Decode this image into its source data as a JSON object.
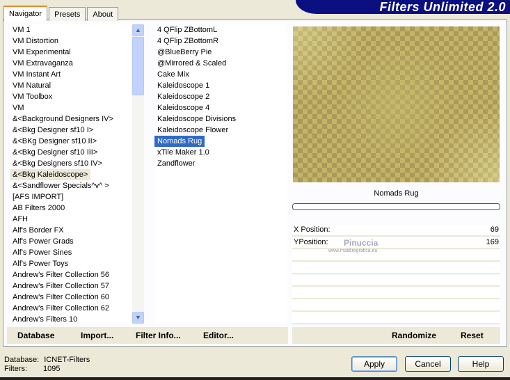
{
  "app": {
    "title": "Filters Unlimited 2.0"
  },
  "tabs": [
    {
      "label": "Navigator"
    },
    {
      "label": "Presets"
    },
    {
      "label": "About"
    }
  ],
  "categories": [
    "VM 1",
    "VM Distortion",
    "VM Experimental",
    "VM Extravaganza",
    "VM Instant Art",
    "VM Natural",
    "VM Toolbox",
    "VM",
    "&<Background Designers IV>",
    "&<Bkg Designer sf10 I>",
    "&<BKg Designer sf10 II>",
    "&<Bkg Designer sf10 III>",
    "&<Bkg Designers sf10 IV>",
    "&<Bkg Kaleidoscope>",
    "&<Sandflower Specials^v^ >",
    "[AFS IMPORT]",
    "AB Filters 2000",
    "AFH",
    "Alf's Border FX",
    "Alf's Power Grads",
    "Alf's Power Sines",
    "Alf's Power Toys",
    "Andrew's Filter Collection 56",
    "Andrew's Filter Collection 57",
    "Andrew's Filter Collection 60",
    "Andrew's Filter Collection 62",
    "Andrew's Filters 10"
  ],
  "selected_category": "&<Bkg Kaleidoscope>",
  "filters": [
    "4 QFlip ZBottomL",
    "4 QFlip ZBottomR",
    "@BlueBerry Pie",
    "@Mirrored & Scaled",
    "Cake Mix",
    "Kaleidoscope 1",
    "Kaleidoscope 2",
    "Kaleidoscope 4",
    "Kaleidoscope Divisions",
    "Kaleidoscope Flower",
    "Nomads Rug",
    "xTile Maker 1.0",
    "Zandflower"
  ],
  "selected_filter": "Nomads Rug",
  "preview": {
    "filter_name": "Nomads Rug",
    "watermark": "Pinuccia",
    "watermark_url": "www.maidiregrafica.eu"
  },
  "params": [
    {
      "label": "X Position:",
      "value": "69"
    },
    {
      "label": "YPosition:",
      "value": "169"
    }
  ],
  "buttons": {
    "database": "Database",
    "import": "Import...",
    "filter_info": "Filter Info...",
    "editor": "Editor...",
    "randomize": "Randomize",
    "reset": "Reset",
    "apply": "Apply",
    "cancel": "Cancel",
    "help": "Help"
  },
  "status": {
    "database_label": "Database:",
    "database_value": "ICNET-Filters",
    "filters_label": "Filters:",
    "filters_value": "1095"
  }
}
